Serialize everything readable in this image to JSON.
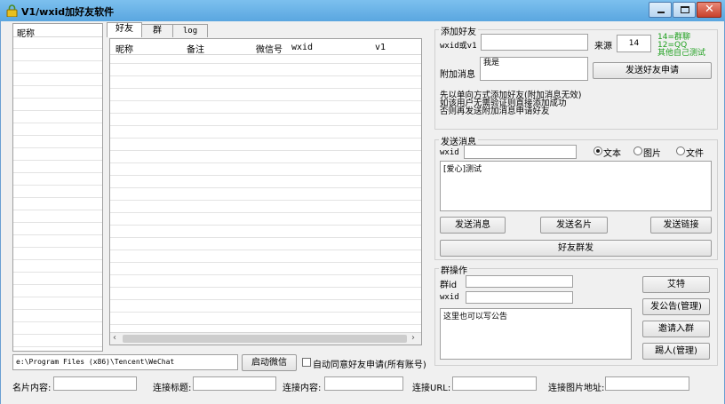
{
  "window": {
    "title": "V1/wxid加好友软件"
  },
  "left_list": {
    "header": "昵称"
  },
  "tabs": [
    "好友",
    "群",
    "log"
  ],
  "friend_table": {
    "columns": [
      "昵称",
      "备注",
      "微信号",
      "wxid",
      "v1"
    ]
  },
  "add_friend": {
    "group_label": "添加好友",
    "wxid_label": "wxid或v1",
    "wxid_value": "",
    "source_label": "来源",
    "source_value": "14",
    "source_hint": [
      "14=群聊",
      "12=QQ",
      "其他自己测试"
    ],
    "message_label": "附加消息",
    "message_value": "我是",
    "send_button": "发送好友申请",
    "notes": [
      "先以单向方式添加好友(附加消息无效)",
      "如该用户无需验证则直接添加成功",
      "否则再发送附加消息申请好友"
    ]
  },
  "send_message": {
    "group_label": "发送消息",
    "wxid_label": "wxid",
    "wxid_value": "",
    "radio_text": "文本",
    "radio_image": "图片",
    "radio_file": "文件",
    "content": "[爱心]测试",
    "btn_send": "发送消息",
    "btn_card": "发送名片",
    "btn_link": "发送链接",
    "btn_mass": "好友群发"
  },
  "group_ops": {
    "group_label": "群操作",
    "groupid_label": "群id",
    "groupid_value": "",
    "wxid_label": "wxid",
    "wxid_value": "",
    "announcement": "这里也可以写公告",
    "btn_at": "艾特",
    "btn_notice": "发公告(管理)",
    "btn_invite": "邀请入群",
    "btn_kick": "踢人(管理)"
  },
  "bottom": {
    "path_value": "e:\\Program Files (x86)\\Tencent\\WeChat",
    "start_button": "启动微信",
    "auto_accept_label": "自动同意好友申请(所有账号)",
    "card_content_label": "名片内容:",
    "link_title_label": "连接标题:",
    "link_content_label": "连接内容:",
    "link_url_label": "连接URL:",
    "link_image_label": "连接图片地址:"
  },
  "colors": {
    "titlebar": "#5aa6e0",
    "hint_green": "#20a020",
    "close_red": "#c8412c"
  }
}
